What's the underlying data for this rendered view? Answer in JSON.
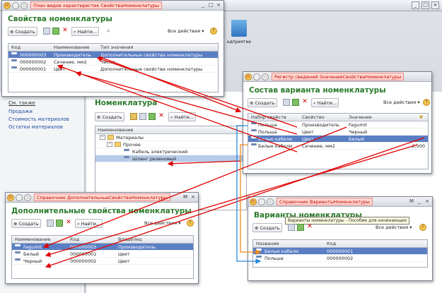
{
  "colors": {
    "title_green": "#2a7a2a",
    "caption_red": "#c00000",
    "selection": "#5a7ec4",
    "arrow_red": "#e00000",
    "arrow_blue": "#2a8ad8",
    "arrow_orange": "#f08a1c"
  },
  "app": {
    "predpriyatie_label": "едприятие"
  },
  "left": {
    "see_also": "См. также",
    "links": [
      "Продажи",
      "Стоимость материалов",
      "Остатки материалов"
    ]
  },
  "nom": {
    "title": "Номенклатура",
    "create": "Создать",
    "find": "Найти...",
    "col": "Наименование",
    "tree": [
      "Материалы",
      "Прочее",
      "Кабель электрический",
      "Шланг резиновый"
    ]
  },
  "w1": {
    "caption": "План видов характеристик СвойстваНоменклатуры",
    "heading": "Свойства номенклатуры",
    "create": "Создать",
    "find": "Найти...",
    "all_actions": "Все действия ▾",
    "cols": [
      "Код",
      "Наименование",
      "Тип значения"
    ],
    "rows": [
      [
        "000000003",
        "Производитель",
        "Дополнительные свойства номенклатуры"
      ],
      [
        "000000002",
        "Сечение, мм2",
        "Число"
      ],
      [
        "000000001",
        "Цвет",
        "Дополнительные свойства номенклатуры"
      ]
    ]
  },
  "w2": {
    "caption": "Регистр сведений ЗначениеСвойстваНоменклатуры",
    "heading": "Состав варианта номенклатуры",
    "create": "Создать",
    "find": "Найти...",
    "all_actions": "Все действия ▾",
    "cols": [
      "Набор свойств",
      "Свойство",
      "Значение"
    ],
    "rows": [
      [
        "Польша",
        "Производитель",
        "Fagumit",
        ""
      ],
      [
        "Польша",
        "Цвет",
        "Черный",
        ""
      ],
      [
        "Белые кабели",
        "Цвет",
        "Белый",
        ""
      ],
      [
        "Белые кабели",
        "Сечение, мм2",
        "",
        "2,500"
      ]
    ]
  },
  "w3": {
    "caption": "Справочник ДополнительныеСвойстваНоменклатуры",
    "heading": "Дополнительные свойства номенклатуры",
    "create": "Создать",
    "find": "Найти...",
    "all_actions": "Все действия ▾",
    "cols": [
      "Наименование",
      "Код",
      "Владелец"
    ],
    "rows": [
      [
        "Fagumit",
        "000000003",
        "Производитель"
      ],
      [
        "Белый",
        "000000001",
        "Цвет"
      ],
      [
        "Черный",
        "000000002",
        "Цвет"
      ]
    ]
  },
  "w4": {
    "caption": "Справочник ВариантыНоменклатуры",
    "heading": "Варианты номенклатуры",
    "tooltip": "Варианты номенклатуры - Пособие для начинающих",
    "create": "Создать",
    "all_actions": "Все действия ▾",
    "cols": [
      "Название",
      "Код"
    ],
    "rows": [
      [
        "Белые кабели",
        "000000001"
      ],
      [
        "Польша",
        "000000002"
      ]
    ]
  }
}
